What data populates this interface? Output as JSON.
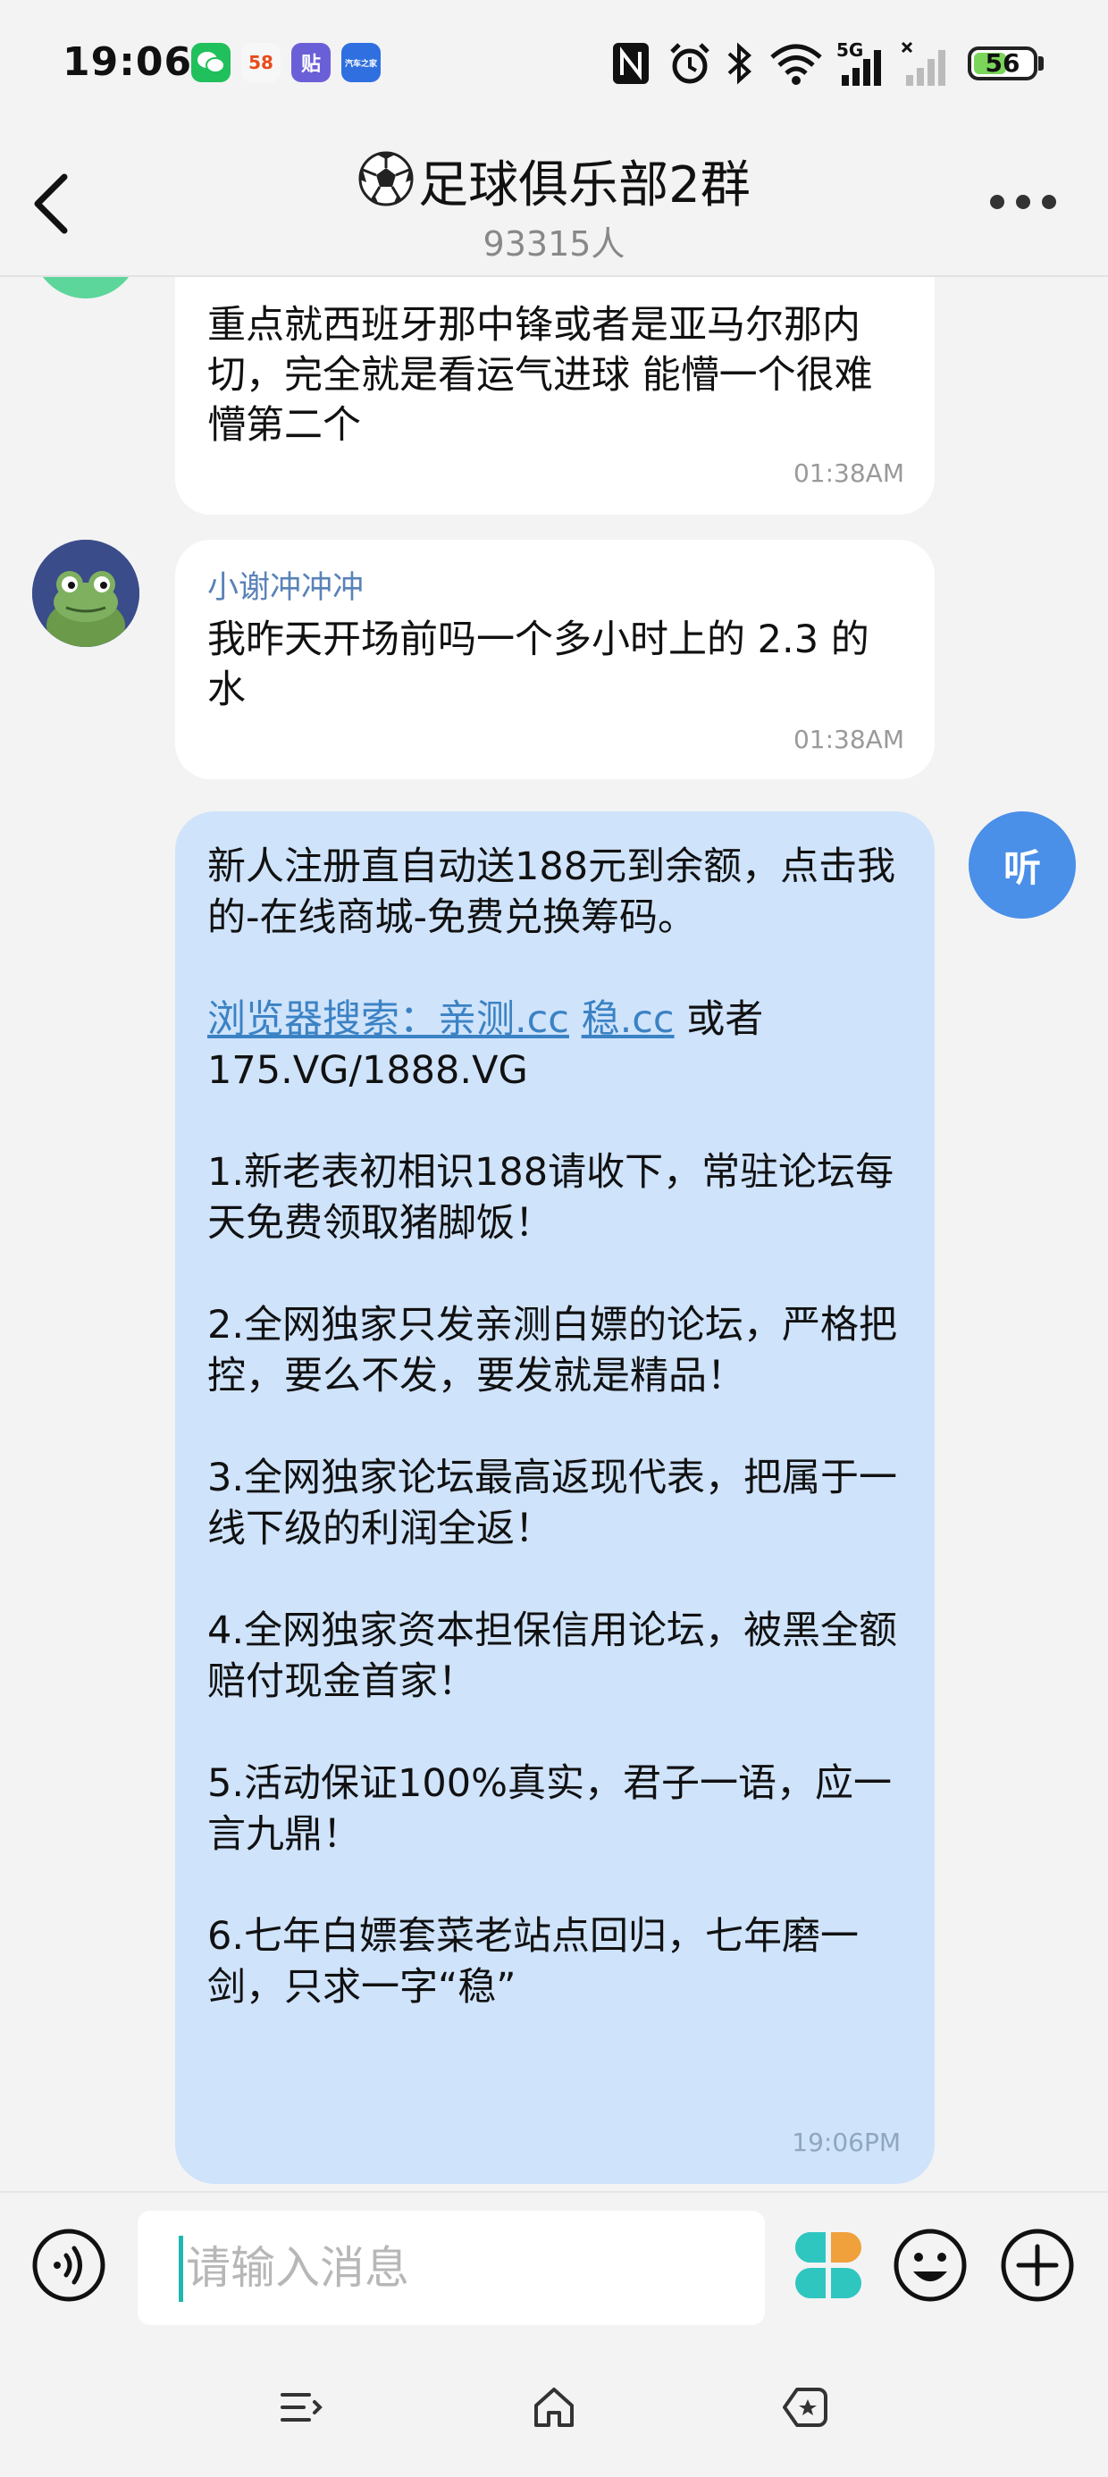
{
  "status_bar": {
    "time": "19:06",
    "battery": "56",
    "battery_level": 0.56,
    "network": "5G",
    "apps": [
      {
        "name": "wechat-icon",
        "color": "#20c05c"
      },
      {
        "name": "58-app-icon",
        "label": "58",
        "color": "#f7f7f7"
      },
      {
        "name": "tieba-icon",
        "label": "贴",
        "color": "#6b5fd8"
      },
      {
        "name": "autohome-icon",
        "label": "汽车之家",
        "color": "#2f6fe0"
      }
    ]
  },
  "header": {
    "title": "足球俱乐部2群",
    "member_count": "93315人"
  },
  "messages": [
    {
      "text": "重点就西班牙那中锋或者是亚马尔那内切，完全就是看运气进球 能懵一个很难懵第二个",
      "time": "01:38AM"
    },
    {
      "sender": "小谢冲冲冲",
      "text": "我昨天开场前吗一个多小时上的 2.3 的水",
      "time": "01:38AM"
    }
  ],
  "my_message": {
    "avatar_label": "听",
    "line1": "新人注册直自动送188元到余额，点击我的-在线商城-免费兑换筹码。",
    "link1": "浏览器搜索：亲测.cc",
    "link2": "稳.cc",
    "or_text": " 或者",
    "domains": "175.VG/1888.VG",
    "items": [
      "1.新老表初相识188请收下，常驻论坛每天免费领取猪脚饭！",
      "2.全网独家只发亲测白嫖的论坛，严格把控，要么不发，要发就是精品！",
      "3.全网独家论坛最高返现代表，把属于一线下级的利润全返！",
      "4.全网独家资本担保信用论坛，被黑全额赔付现金首家！",
      "5.活动保证100%真实，君子一语，应一言九鼎！",
      "6.七年白嫖套菜老站点回归，七年磨一剑，只求一字“稳”"
    ],
    "time": "19:06PM"
  },
  "input_bar": {
    "placeholder": "请输入消息"
  },
  "colors": {
    "my_bubble": "#cfe3fb",
    "accent_blue": "#4a8fe8",
    "link": "#3b82c4",
    "cursor": "#1fb8b0"
  }
}
